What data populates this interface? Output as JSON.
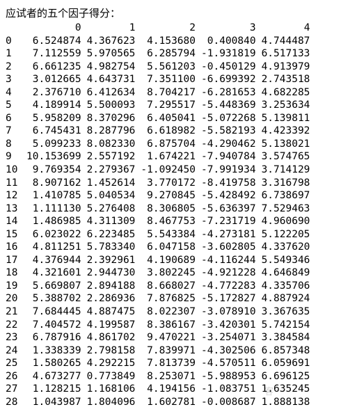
{
  "title": "应试者的五个因子得分：",
  "columns": [
    "0",
    "1",
    "2",
    "3",
    "4"
  ],
  "rows": [
    {
      "idx": "0",
      "c": [
        "6.524874",
        "4.367623",
        "4.153680",
        "0.400840",
        "4.744487"
      ]
    },
    {
      "idx": "1",
      "c": [
        "7.112559",
        "5.970565",
        "6.285794",
        "-1.931819",
        "6.517133"
      ]
    },
    {
      "idx": "2",
      "c": [
        "6.661235",
        "4.982754",
        "5.561203",
        "-0.450129",
        "4.913979"
      ]
    },
    {
      "idx": "3",
      "c": [
        "3.012665",
        "4.643731",
        "7.351100",
        "-6.699392",
        "2.743518"
      ]
    },
    {
      "idx": "4",
      "c": [
        "2.376710",
        "6.412634",
        "8.704217",
        "-6.281653",
        "4.682285"
      ]
    },
    {
      "idx": "5",
      "c": [
        "4.189914",
        "5.500093",
        "7.295517",
        "-5.448369",
        "3.253634"
      ]
    },
    {
      "idx": "6",
      "c": [
        "5.958209",
        "8.370296",
        "6.405041",
        "-5.072268",
        "5.139811"
      ]
    },
    {
      "idx": "7",
      "c": [
        "6.745431",
        "8.287796",
        "6.618982",
        "-5.582193",
        "4.423392"
      ]
    },
    {
      "idx": "8",
      "c": [
        "5.099233",
        "8.082330",
        "6.875704",
        "-4.290462",
        "5.138021"
      ]
    },
    {
      "idx": "9",
      "c": [
        "10.153699",
        "2.557192",
        "1.674221",
        "-7.940784",
        "3.574765"
      ]
    },
    {
      "idx": "10",
      "c": [
        "9.769354",
        "2.279367",
        "-1.092450",
        "-7.991934",
        "3.714129"
      ]
    },
    {
      "idx": "11",
      "c": [
        "8.907162",
        "1.452614",
        "3.770172",
        "-8.419758",
        "3.316798"
      ]
    },
    {
      "idx": "12",
      "c": [
        "1.410785",
        "5.040534",
        "9.270845",
        "-5.428492",
        "6.738697"
      ]
    },
    {
      "idx": "13",
      "c": [
        "1.111130",
        "5.276408",
        "8.306805",
        "-5.636397",
        "7.529463"
      ]
    },
    {
      "idx": "14",
      "c": [
        "1.486985",
        "4.311309",
        "8.467753",
        "-7.231719",
        "4.960690"
      ]
    },
    {
      "idx": "15",
      "c": [
        "6.023022",
        "6.223485",
        "5.543384",
        "-4.273181",
        "5.122205"
      ]
    },
    {
      "idx": "16",
      "c": [
        "4.811251",
        "5.783340",
        "6.047158",
        "-3.602805",
        "4.337620"
      ]
    },
    {
      "idx": "17",
      "c": [
        "4.376944",
        "2.392961",
        "4.190689",
        "-4.116244",
        "5.549346"
      ]
    },
    {
      "idx": "18",
      "c": [
        "4.321601",
        "2.944730",
        "3.802245",
        "-4.921228",
        "4.646849"
      ]
    },
    {
      "idx": "19",
      "c": [
        "5.669807",
        "2.894188",
        "8.668027",
        "-4.772283",
        "4.335706"
      ]
    },
    {
      "idx": "20",
      "c": [
        "5.388702",
        "2.286936",
        "7.876825",
        "-5.172827",
        "4.887924"
      ]
    },
    {
      "idx": "21",
      "c": [
        "7.684445",
        "4.887475",
        "8.022307",
        "-3.078910",
        "3.367635"
      ]
    },
    {
      "idx": "22",
      "c": [
        "7.404572",
        "4.199587",
        "8.386167",
        "-3.420301",
        "5.742154"
      ]
    },
    {
      "idx": "23",
      "c": [
        "6.787916",
        "4.861702",
        "9.470221",
        "-3.254071",
        "3.384584"
      ]
    },
    {
      "idx": "24",
      "c": [
        "1.338339",
        "2.798158",
        "7.839971",
        "-4.302506",
        "6.857348"
      ]
    },
    {
      "idx": "25",
      "c": [
        "1.580265",
        "4.292215",
        "7.813739",
        "-4.570511",
        "6.059691"
      ]
    },
    {
      "idx": "26",
      "c": [
        "4.673277",
        "0.773849",
        "8.253071",
        "-5.988953",
        "6.696125"
      ]
    },
    {
      "idx": "27",
      "c": [
        "1.128215",
        "1.168106",
        "4.194156",
        "-1.083751",
        "1.635245"
      ]
    },
    {
      "idx": "28",
      "c": [
        "1.043987",
        "1.804096",
        "1.602781",
        "-0.008687",
        "1.888138"
      ]
    }
  ],
  "watermark": "客"
}
